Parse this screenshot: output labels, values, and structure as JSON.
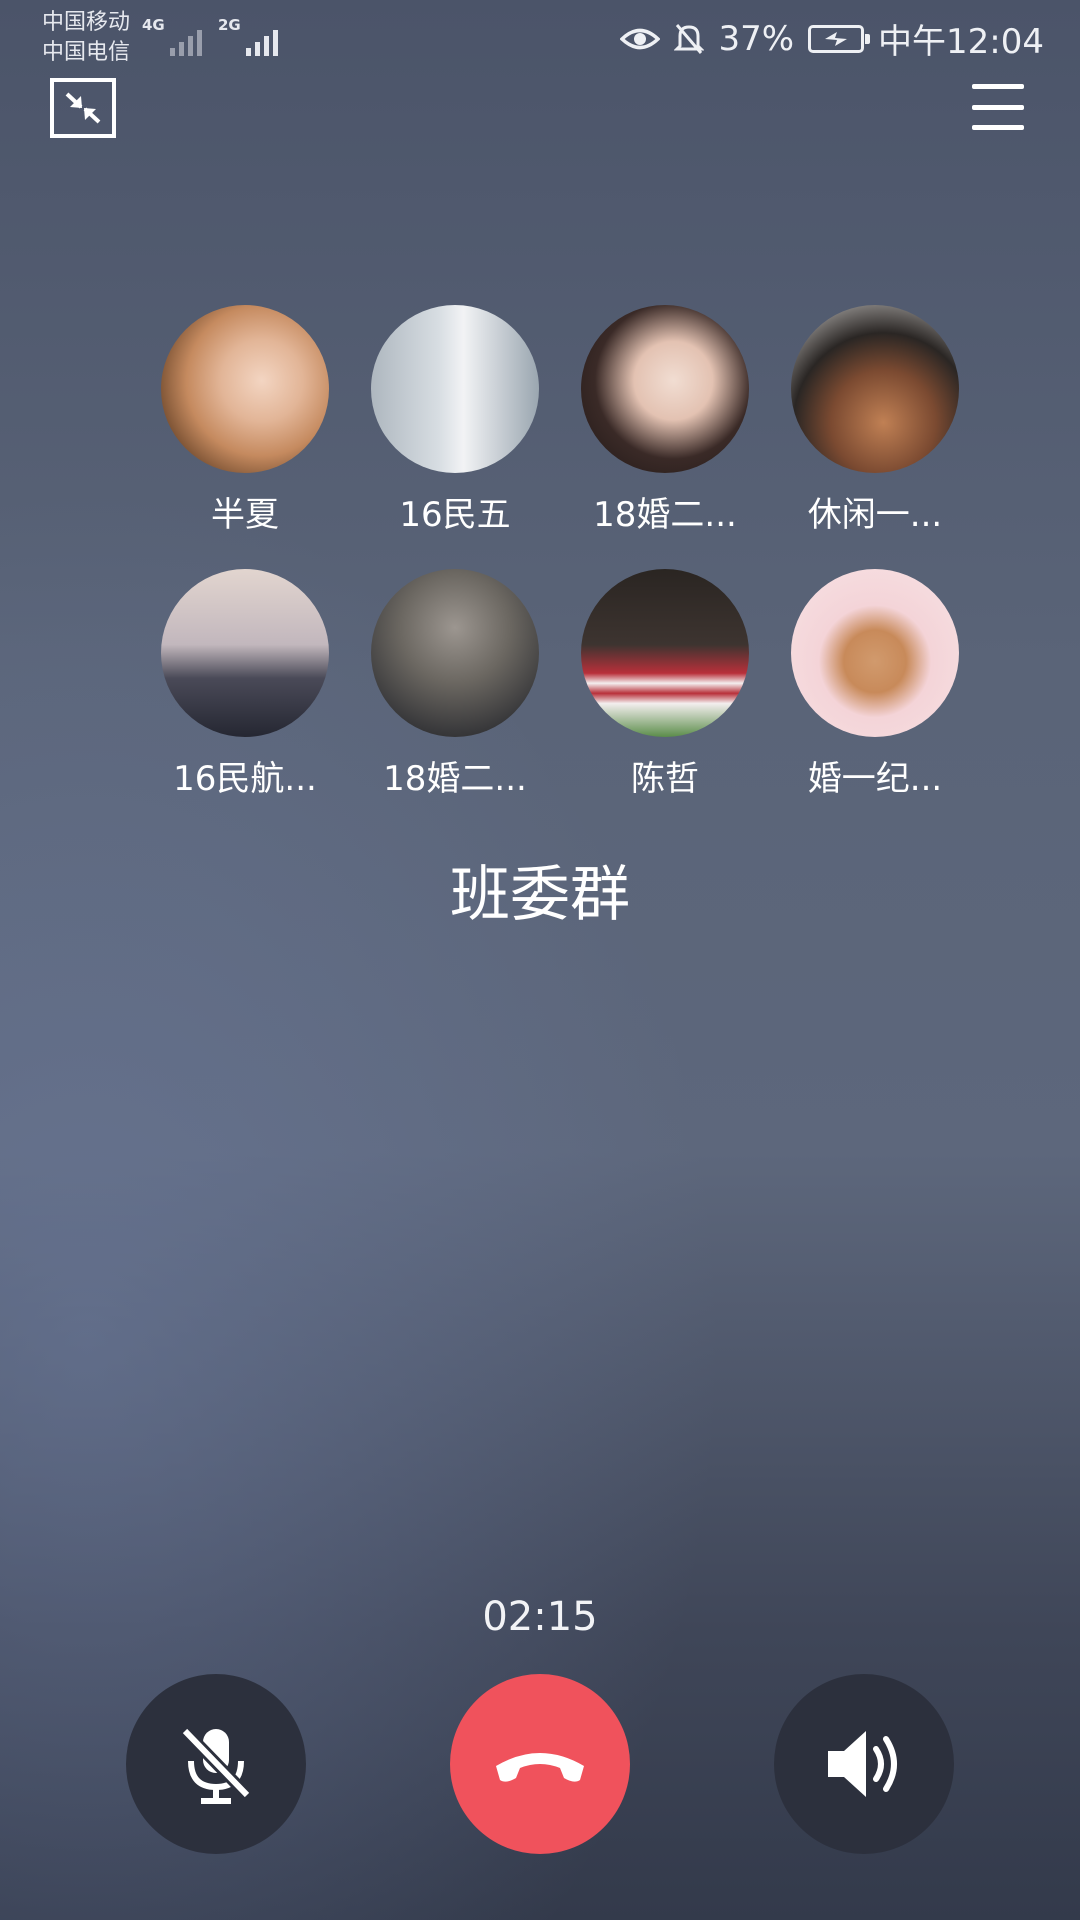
{
  "status_bar": {
    "carrier_1": "中国移动",
    "carrier_2": "中国电信",
    "network_1": "4G",
    "network_2": "2G",
    "battery": "37%",
    "time": "中午12:04"
  },
  "call": {
    "group_name": "班委群",
    "duration": "02:15"
  },
  "members": [
    {
      "name": "半夏"
    },
    {
      "name": "16民五"
    },
    {
      "name": "18婚二..."
    },
    {
      "name": "休闲一..."
    },
    {
      "name": "16民航..."
    },
    {
      "name": "18婚二..."
    },
    {
      "name": "陈哲"
    },
    {
      "name": "婚一纪..."
    }
  ],
  "controls": {
    "mute": "microphone-off-icon",
    "hangup": "phone-hangup-icon",
    "speaker": "speaker-icon"
  },
  "colors": {
    "hangup": "#f0525c",
    "control_bg": "#2c303d"
  }
}
